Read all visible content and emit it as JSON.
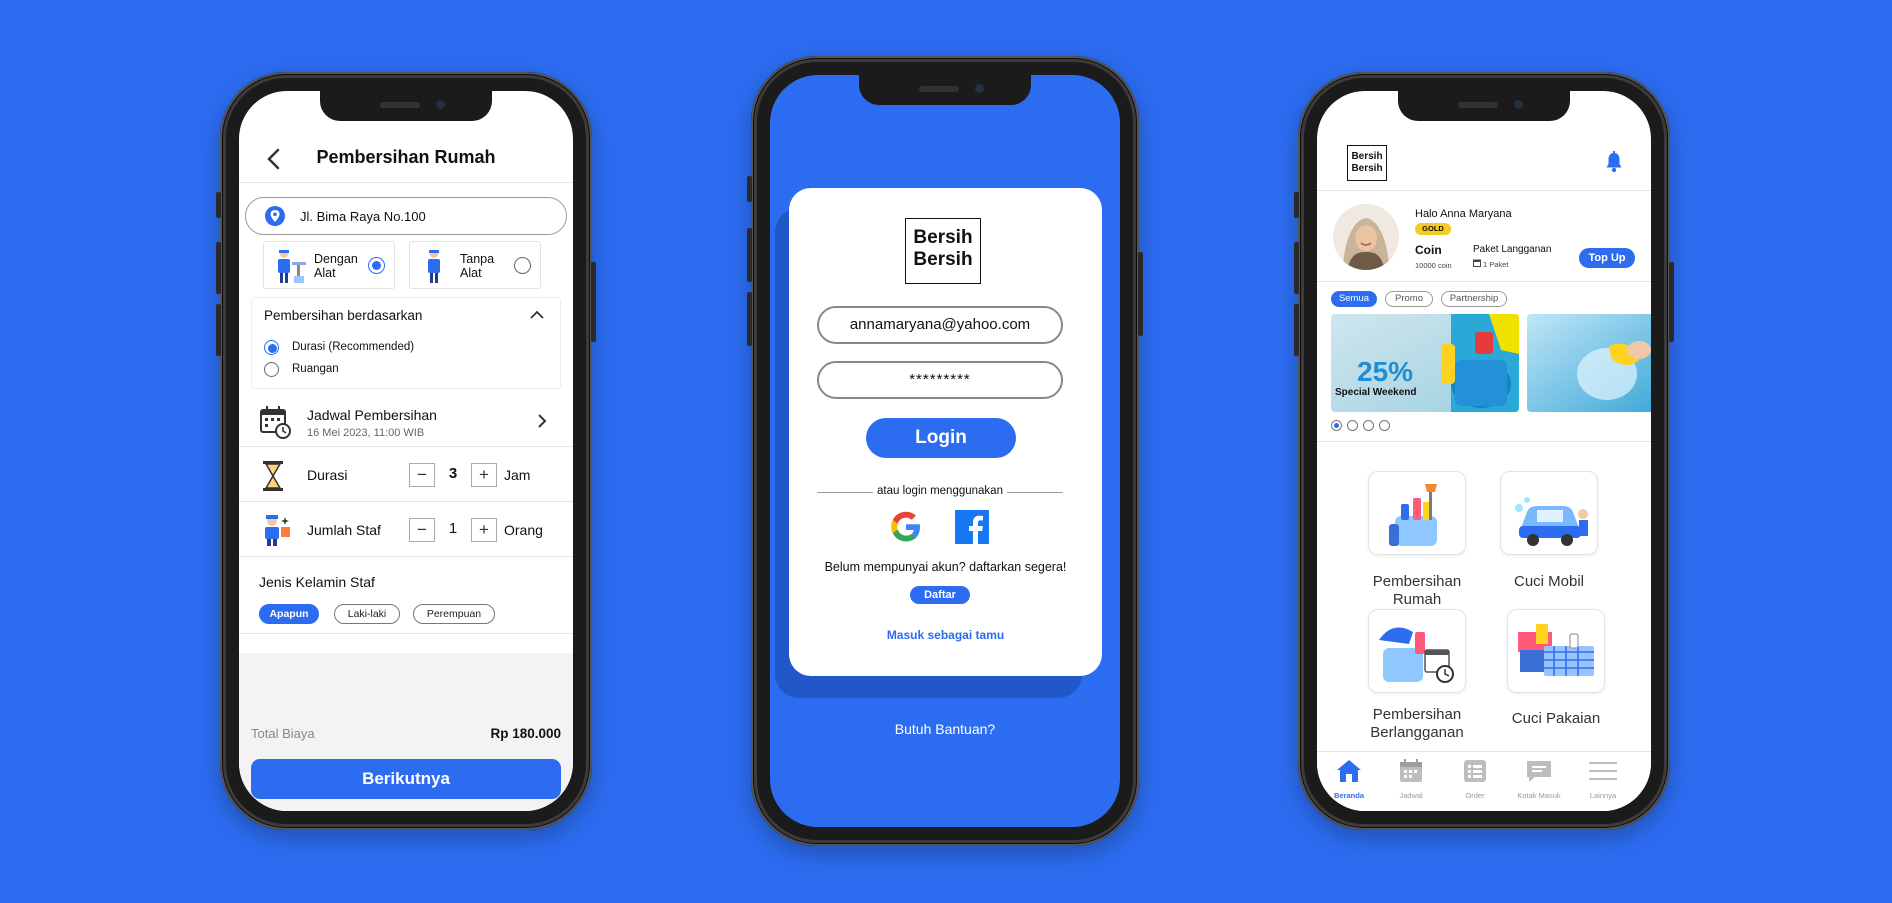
{
  "detail_screen": {
    "title": "Pembersihan Rumah",
    "address": "Jl. Bima Raya No.100",
    "tool_options": [
      {
        "label": "Dengan Alat",
        "selected": true
      },
      {
        "label": "Tanpa Alat",
        "selected": false
      }
    ],
    "basis": {
      "title": "Pembersihan berdasarkan",
      "options": [
        {
          "label": "Durasi (Recommended)",
          "selected": true
        },
        {
          "label": "Ruangan",
          "selected": false
        }
      ]
    },
    "schedule": {
      "label": "Jadwal Pembersihan",
      "value": "16 Mei 2023, 11:00 WIB"
    },
    "duration": {
      "label": "Durasi",
      "minus": "−",
      "value": "3",
      "plus": "+",
      "unit": "Jam"
    },
    "staff": {
      "label": "Jumlah Staf",
      "minus": "−",
      "value": "1",
      "plus": "+",
      "unit": "Orang"
    },
    "gender": {
      "label": "Jenis Kelamin Staf",
      "options": [
        {
          "label": "Apapun",
          "selected": true
        },
        {
          "label": "Laki-laki",
          "selected": false
        },
        {
          "label": "Perempuan",
          "selected": false
        }
      ]
    },
    "total_label": "Total Biaya",
    "total_value": "Rp 180.000",
    "next_button": "Berikutnya"
  },
  "login_screen": {
    "logo_line1": "Bersih",
    "logo_line2": "Bersih",
    "email": "annamaryana@yahoo.com",
    "password": "*********",
    "login_button": "Login",
    "divider_text": "atau login menggunakan",
    "register_text": "Belum mempunyai akun? daftarkan segera!",
    "register_button": "Daftar",
    "guest_link": "Masuk sebagai tamu",
    "help_link": "Butuh Bantuan?"
  },
  "home_screen": {
    "logo_line1": "Bersih",
    "logo_line2": "Bersih",
    "greeting": "Halo Anna Maryana",
    "tier": "GOLD",
    "coin_label": "Coin",
    "coin_value": "10000 coin",
    "package_label": "Paket Langganan",
    "package_value": "1 Paket",
    "topup_button": "Top Up",
    "filters": [
      {
        "label": "Semua",
        "selected": true
      },
      {
        "label": "Promo",
        "selected": false
      },
      {
        "label": "Partnership",
        "selected": false
      }
    ],
    "banner": {
      "percent": "25%",
      "caption": "Special Weekend"
    },
    "banner_dots": 4,
    "active_dot": 0,
    "services": [
      {
        "label": "Pembersihan Rumah",
        "icon": "house-cleaning-icon"
      },
      {
        "label": "Cuci Mobil",
        "icon": "car-wash-icon"
      },
      {
        "label": "Pembersihan Berlangganan",
        "icon": "subscription-cleaning-icon"
      },
      {
        "label": "Cuci Pakaian",
        "icon": "laundry-icon"
      }
    ],
    "nav": [
      {
        "label": "Beranda",
        "icon": "home-icon",
        "active": true
      },
      {
        "label": "Jadwal",
        "icon": "calendar-icon",
        "active": false
      },
      {
        "label": "Order",
        "icon": "order-icon",
        "active": false
      },
      {
        "label": "Kotak Masuk",
        "icon": "inbox-icon",
        "active": false
      },
      {
        "label": "Lainnya",
        "icon": "menu-icon",
        "active": false
      }
    ]
  },
  "colors": {
    "primary": "#2c6cf0",
    "gold": "#f5cc24",
    "background": "#2c6cf0"
  }
}
